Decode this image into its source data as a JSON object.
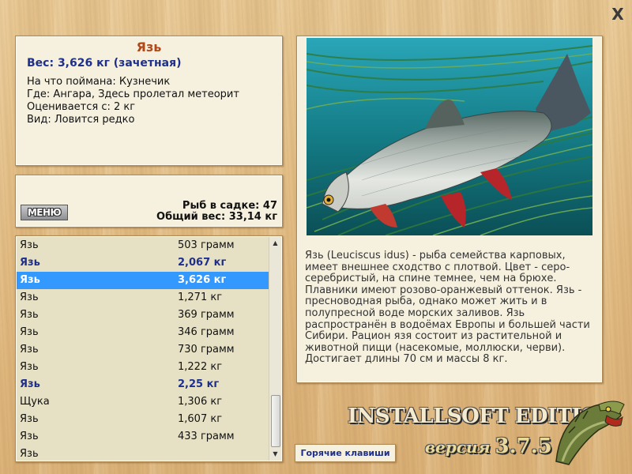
{
  "window": {
    "close_label": "X"
  },
  "info": {
    "title": "Язь",
    "weight": "Вес: 3,626 кг (зачетная)",
    "lines": [
      "На что поймана: Кузнечик",
      "Где: Ангара, Здесь пролетал метеорит",
      "Оценивается с: 2 кг",
      "Вид: Ловится редко"
    ]
  },
  "stats": {
    "menu_label": "МЕНЮ",
    "fish_in_cage": "Рыб в садке: 47",
    "total_weight": "Общий вес: 33,14 кг"
  },
  "catch_list": [
    {
      "name": "Язь",
      "weight": "503 грамм",
      "style": "normal"
    },
    {
      "name": "Язь",
      "weight": "2,067 кг",
      "style": "bold"
    },
    {
      "name": "Язь",
      "weight": "3,626 кг",
      "style": "selected"
    },
    {
      "name": "Язь",
      "weight": "1,271 кг",
      "style": "normal"
    },
    {
      "name": "Язь",
      "weight": "369 грамм",
      "style": "normal"
    },
    {
      "name": "Язь",
      "weight": "346 грамм",
      "style": "normal"
    },
    {
      "name": "Язь",
      "weight": "730 грамм",
      "style": "normal"
    },
    {
      "name": "Язь",
      "weight": "1,222 кг",
      "style": "normal"
    },
    {
      "name": "Язь",
      "weight": "2,25 кг",
      "style": "bold"
    },
    {
      "name": "Щука",
      "weight": "1,306 кг",
      "style": "normal"
    },
    {
      "name": "Язь",
      "weight": "1,607 кг",
      "style": "normal"
    },
    {
      "name": "Язь",
      "weight": "433 грамм",
      "style": "normal"
    },
    {
      "name": "Язь",
      "weight": "",
      "style": "normal"
    }
  ],
  "description": "Язь (Leuciscus idus) - рыба семейства карповых, имеет внешнее сходство с плотвой. Цвет - серо-серебристый, на спине темнее, чем на брюхе. Плавники имеют розово-оранжевый оттенок. Язь - пресноводная рыба, однако может жить и в полупресной воде морских заливов. Язь распространён в водоёмах Европы и большей части Сибири. Рацион язя состоит из растительной и животной пищи (насекомые, моллюски, черви). Достигает длины 70 см и массы 8 кг.",
  "footer": {
    "hotkeys_label": "Горячие клавиши",
    "brand": "INSTALLSOFT EDITION",
    "version_label": "версия",
    "version_number": "3.7.5"
  },
  "colors": {
    "background": "#e5c088",
    "panel": "#f6f1df",
    "title_accent": "#b0481c",
    "emphasis_blue": "#1e2f8c",
    "selection": "#3399ff"
  }
}
